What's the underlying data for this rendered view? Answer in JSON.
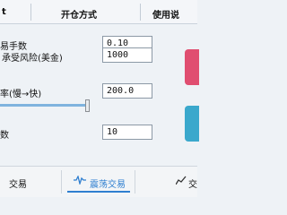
{
  "header": {
    "col1": "t",
    "col2": "开仓方式",
    "col3": "使用说"
  },
  "rows": [
    {
      "label": "易手数",
      "value": "0.10"
    },
    {
      "label": "承受风险(美金)",
      "value": "1000"
    },
    {
      "label": "率(慢→快)",
      "value": "200.0"
    },
    {
      "label": "数",
      "value": "10"
    }
  ],
  "slider": {
    "value_fraction": 0.45
  },
  "tabs": {
    "left": "交易",
    "middle": "震荡交易",
    "right": "交"
  },
  "colors": {
    "pink_button": "#e04e70",
    "teal_button": "#3aa8cc",
    "accent": "#2f7fd0"
  },
  "icons": [
    "wave-icon",
    "chart-icon"
  ]
}
